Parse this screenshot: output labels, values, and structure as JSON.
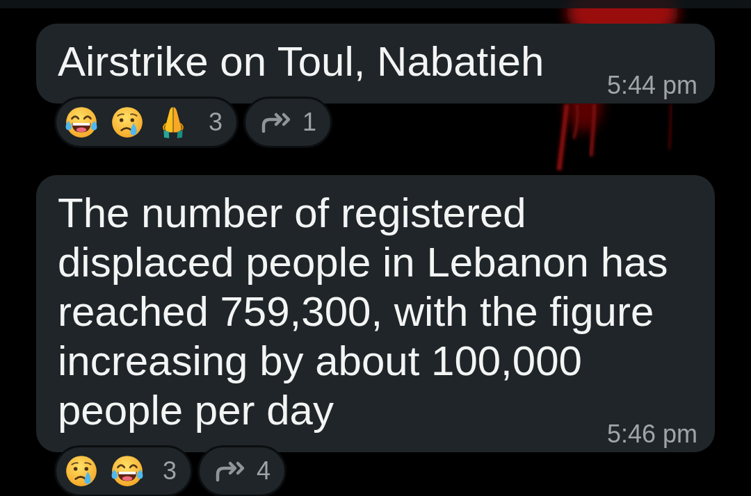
{
  "messages": [
    {
      "text": "Airstrike on Toul, Nabatieh",
      "time": "5:44 pm",
      "reactions": {
        "emojis": [
          {
            "kind": "joy"
          },
          {
            "kind": "cry"
          },
          {
            "kind": "pray"
          }
        ],
        "count": "3"
      },
      "forwards": {
        "count": "1"
      }
    },
    {
      "text": "The number of registered displaced people in Lebanon has reached 759,300, with the figure increasing by about 100,000 people per day",
      "time": "5:46 pm",
      "reactions": {
        "emojis": [
          {
            "kind": "cry"
          },
          {
            "kind": "joy"
          }
        ],
        "count": "3"
      },
      "forwards": {
        "count": "4"
      }
    }
  ]
}
